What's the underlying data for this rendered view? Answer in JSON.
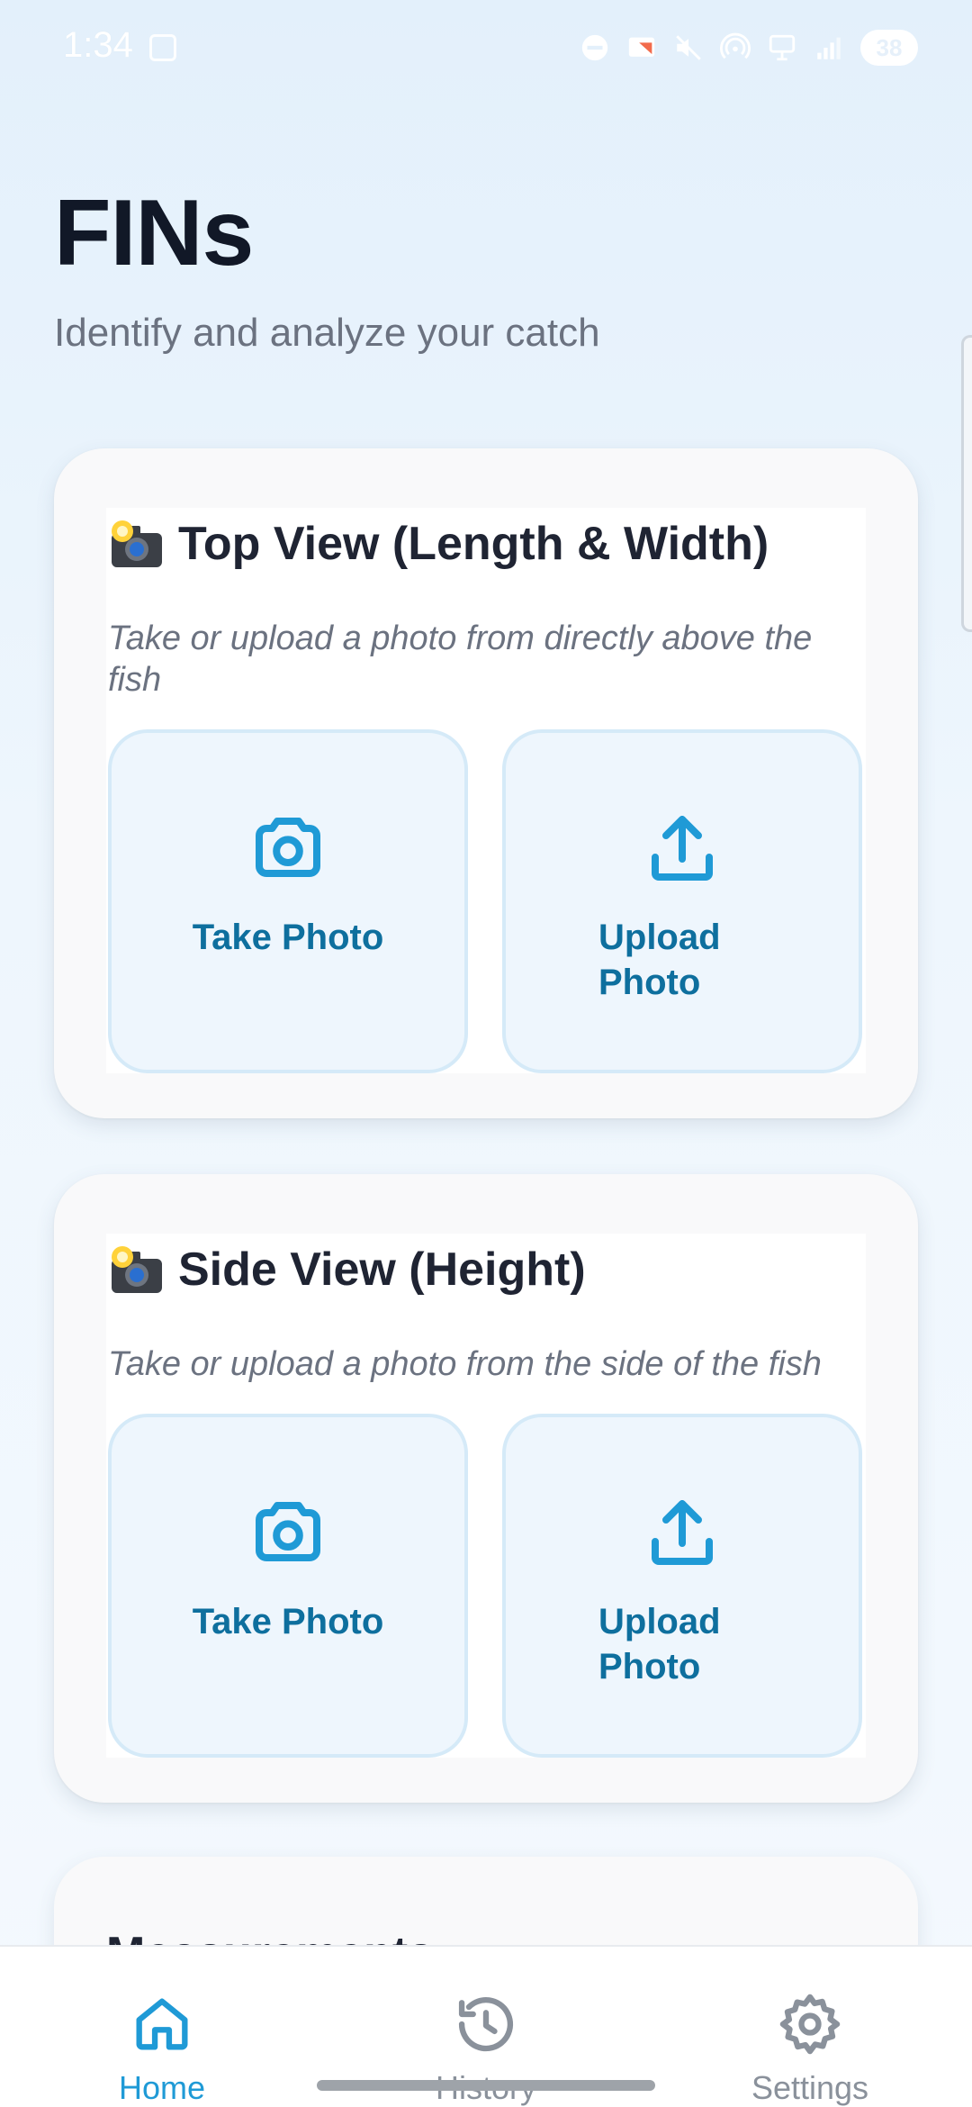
{
  "status": {
    "time": "1:34",
    "battery": "38"
  },
  "header": {
    "title": "FINs",
    "subtitle": "Identify and analyze your catch"
  },
  "cards": [
    {
      "title": "Top View (Length & Width)",
      "description": "Take or upload a photo from directly above the fish",
      "take_label": "Take Photo",
      "upload_label": "Upload Photo"
    },
    {
      "title": "Side View (Height)",
      "description": "Take or upload a photo from the side of the fish",
      "take_label": "Take Photo",
      "upload_label": "Upload Photo"
    }
  ],
  "next_section": {
    "title": "Measurements"
  },
  "nav": {
    "items": [
      {
        "label": "Home",
        "icon": "home-icon",
        "active": true
      },
      {
        "label": "History",
        "icon": "history-icon",
        "active": false
      },
      {
        "label": "Settings",
        "icon": "gear-icon",
        "active": false
      }
    ]
  },
  "colors": {
    "accent": "#1f9ad6",
    "button_text": "#0e6f9e",
    "button_bg": "#eef6fd"
  }
}
